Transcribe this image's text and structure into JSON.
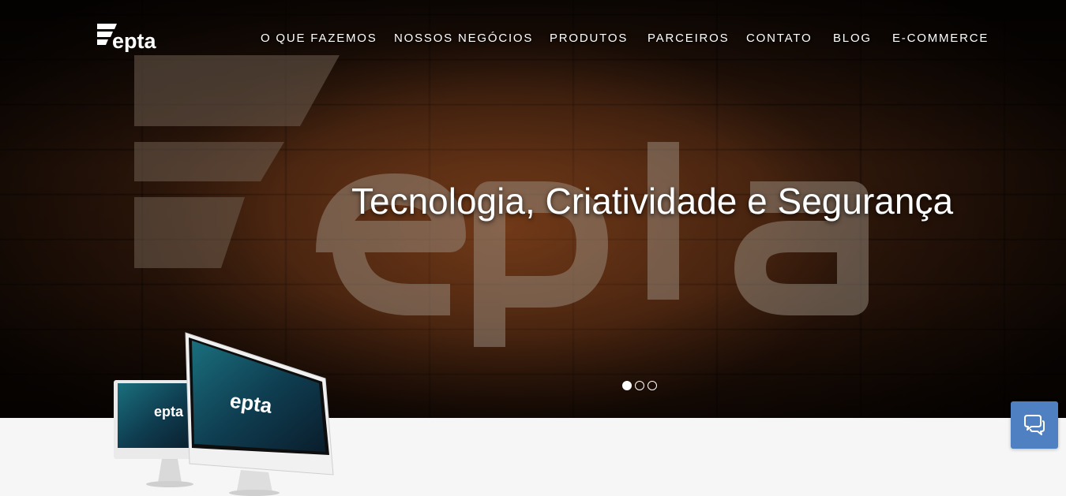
{
  "brand": {
    "logo_text": "epta"
  },
  "nav": {
    "items": [
      {
        "label": "O QUE FAZEMOS"
      },
      {
        "label": "NOSSOS NEGÓCIOS"
      },
      {
        "label": "PRODUTOS"
      },
      {
        "label": "PARCEIROS"
      },
      {
        "label": "CONTATO"
      },
      {
        "label": "BLOG"
      },
      {
        "label": "E-COMMERCE"
      }
    ]
  },
  "hero": {
    "headline": "Tecnologia, Criatividade e Segurança",
    "slides": {
      "count": 3,
      "active": 1
    }
  },
  "devices": {
    "screen_logo_text": "epta"
  },
  "chat": {
    "icon": "chat-bubbles-icon"
  },
  "colors": {
    "chat_button": "#4f80c1",
    "page_background": "#f6f6f6"
  }
}
